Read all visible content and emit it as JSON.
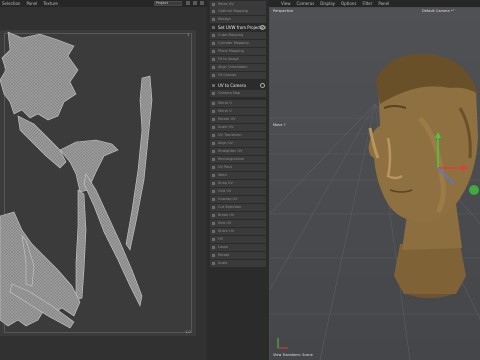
{
  "uv_editor": {
    "menu": [
      "Selection",
      "Panel",
      "Texture"
    ],
    "mode": "Project",
    "corner_top_right": "1",
    "corner_bottom_right": "1,0"
  },
  "tools": {
    "items": [
      {
        "label": "Relax UV",
        "style": "dim"
      },
      {
        "label": "Optimal Mapping",
        "style": "dim"
      },
      {
        "label": "Realign",
        "style": "dim"
      },
      {
        "label": "Set UVW from Projection",
        "style": "head"
      },
      {
        "label": "Cube Mapping",
        "style": "dim"
      },
      {
        "label": "Cylinder Mapping",
        "style": "dim"
      },
      {
        "label": "Plane Mapping",
        "style": "dim"
      },
      {
        "label": "Fit to Image",
        "style": "dim"
      },
      {
        "label": "Align Orientation",
        "style": "dim"
      },
      {
        "label": "Fit Canvas",
        "style": "dim"
      },
      {
        "label": "UV to Camera",
        "style": "head"
      },
      {
        "label": "Camera Map",
        "style": "dim"
      },
      {
        "label": "Mirror U",
        "style": "dim"
      },
      {
        "label": "Mirror V",
        "style": "dim"
      },
      {
        "label": "Rotate UV",
        "style": "dim"
      },
      {
        "label": "Scale UV",
        "style": "dim"
      },
      {
        "label": "UV Transform",
        "style": "dim"
      },
      {
        "label": "Align UV",
        "style": "dim"
      },
      {
        "label": "Straighten UV",
        "style": "dim"
      },
      {
        "label": "Rectangularize",
        "style": "dim"
      },
      {
        "label": "UV Pack",
        "style": "dim"
      },
      {
        "label": "Weld",
        "style": "dim"
      },
      {
        "label": "Snap UV",
        "style": "dim"
      },
      {
        "label": "Grid UV",
        "style": "dim"
      },
      {
        "label": "Unwrap UV",
        "style": "dim"
      },
      {
        "label": "Cut Selection",
        "style": "dim"
      },
      {
        "label": "Break UV",
        "style": "dim"
      },
      {
        "label": "Sew UV",
        "style": "dim"
      },
      {
        "label": "Stitch UV",
        "style": "dim"
      },
      {
        "label": "Fill",
        "style": "dim"
      },
      {
        "label": "Lasso",
        "style": "dim"
      },
      {
        "label": "Rotate",
        "style": "dim"
      },
      {
        "label": "Scale",
        "style": "dim"
      }
    ]
  },
  "viewport": {
    "menu": [
      "View",
      "Cameras",
      "Display",
      "Options",
      "Filter",
      "Panel"
    ],
    "title": "Perspective",
    "camera": "Default Camera •°",
    "axis_label": "Move ↑",
    "status": "View Transform: Scene",
    "colors": {
      "skin": "#8a6a3a",
      "skin_light": "#b8955a",
      "grid": "#5a5c60"
    }
  }
}
